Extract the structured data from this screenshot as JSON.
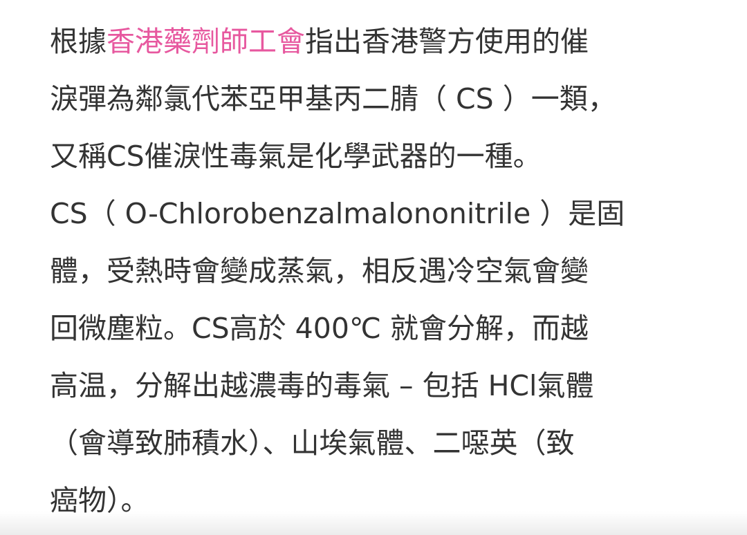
{
  "article": {
    "paragraph_1": {
      "lead_text": "根據",
      "link_text": "香港藥劑師工會",
      "line_1_rest": "指出香港警方使用的催",
      "line_2": "淚彈為鄰氯代苯亞甲基丙二腈（ CS ）一類，",
      "line_3": "又稱CS催淚性毒氣是化學武器的一種。"
    },
    "paragraph_2": {
      "lines": [
        "CS（ O-Chlorobenzalmalononitrile ）是固",
        "體，受熱時會變成蒸氣，相反遇冷空氣會變",
        "回微塵粒。CS高於 400℃ 就會分解，而越",
        "高温，分解出越濃毒的毒氣 – 包括 HCl氣體",
        "（會導致肺積水）、山埃氣體、二噁英（致",
        "癌物）。"
      ]
    }
  },
  "colors": {
    "text": "#333333",
    "link": "#e7589f",
    "background": "#ffffff"
  }
}
